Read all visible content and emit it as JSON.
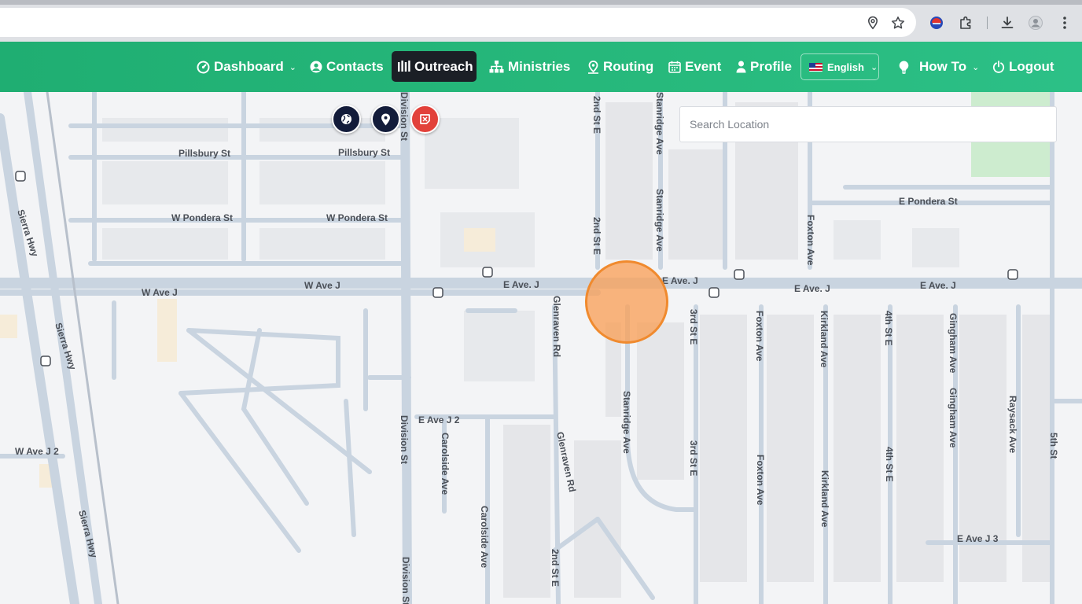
{
  "browser": {
    "icons": [
      "location-pin-icon",
      "star-icon",
      "extension-avatar-icon",
      "puzzle-icon",
      "download-icon",
      "profile-icon",
      "more-icon"
    ]
  },
  "nav": {
    "items": [
      {
        "label": "Dashboard",
        "icon": "dashboard-icon",
        "dropdown": true
      },
      {
        "label": "Contacts",
        "icon": "user-circle-icon"
      },
      {
        "label": "Outreach",
        "icon": "outreach-icon",
        "active": true
      },
      {
        "label": "Ministries",
        "icon": "sitemap-icon"
      },
      {
        "label": "Routing",
        "icon": "route-pin-icon"
      },
      {
        "label": "Event",
        "icon": "calendar-icon"
      },
      {
        "label": "Profile",
        "icon": "user-icon"
      },
      {
        "label": "How To",
        "icon": "lightbulb-icon",
        "dropdown": true
      },
      {
        "label": "Logout",
        "icon": "power-icon"
      }
    ],
    "language": {
      "label": "English",
      "flag": "us-flag-icon"
    }
  },
  "map": {
    "search_placeholder": "Search Location",
    "buttons": [
      "globe-button",
      "pin-button",
      "area-button"
    ],
    "marker_color": "#f08a2e",
    "labels": {
      "pillsbury_west": "Pillsbury St",
      "pillsbury_east": "Pillsbury St",
      "w_pondera_1": "W Pondera St",
      "w_pondera_2": "W Pondera St",
      "e_pondera": "E Pondera St",
      "w_ave_j_1": "W Ave J",
      "w_ave_j_2": "W Ave J",
      "e_ave_j_1": "E Ave. J",
      "e_ave_j_2": "E Ave. J",
      "e_ave_j_3": "E Ave. J",
      "e_ave_j_4": "E Ave. J",
      "sierra_hwy_1": "Sierra Hwy",
      "sierra_hwy_2": "Sierra Hwy",
      "sierra_hwy_3": "Sierra Hwy",
      "division_st_1": "Division St",
      "division_st_2": "Division St",
      "division_st_3": "Division St",
      "second_st_e_1": "2nd St E",
      "second_st_e_2": "2nd St E",
      "second_st_e_3": "2nd St E",
      "staridge_1": "Stanridge Ave",
      "staridge_2": "Stanridge Ave",
      "staridge_3": "Stanridge Ave",
      "third_st_e_1": "3rd St E",
      "third_st_e_2": "3rd St E",
      "foxton_1": "Foxton Ave",
      "foxton_2": "Foxton Ave",
      "foxton_3": "Foxton Ave",
      "kirkland_1": "Kirkland Ave",
      "kirkland_2": "Kirkland Ave",
      "fourth_st_e_1": "4th St E",
      "fourth_st_e_2": "4th St E",
      "gingham_1": "Gingham Ave",
      "gingham_2": "Gingham Ave",
      "raysack": "Raysack Ave",
      "fifth_st": "5th St",
      "glenraven_1": "Glenraven Rd",
      "glenraven_2": "Glenraven Rd",
      "e_ave_j2": "E Ave J 2",
      "w_ave_j2": "W Ave J 2",
      "carolside_1": "Carolside Ave",
      "carolside_2": "Carolside Ave",
      "e_ave_j3": "E Ave J 3"
    }
  }
}
